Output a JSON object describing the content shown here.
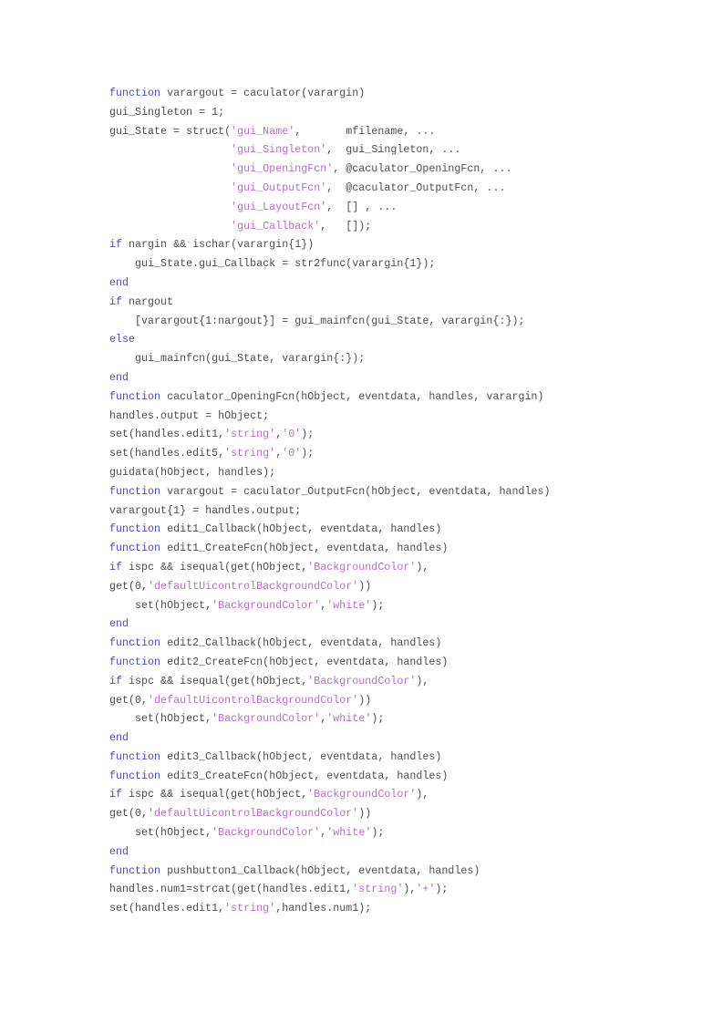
{
  "document": {
    "kind": "source-code-listing",
    "language": "MATLAB",
    "colors": {
      "page_background": "#ffffff",
      "plain_text": "#4d4d4d",
      "keyword": "#4b4bc8",
      "string": "#b96dc8"
    },
    "code_lines": [
      [
        {
          "t": "kw",
          "s": "function"
        },
        {
          "t": "txt",
          "s": " varargout = caculator(varargin)"
        }
      ],
      [
        {
          "t": "txt",
          "s": "gui_Singleton = 1;"
        }
      ],
      [
        {
          "t": "txt",
          "s": "gui_State = struct("
        },
        {
          "t": "str",
          "s": "'gui_Name'"
        },
        {
          "t": "txt",
          "s": ",       mfilename, ..."
        }
      ],
      [
        {
          "t": "txt",
          "s": "                   "
        },
        {
          "t": "str",
          "s": "'gui_Singleton'"
        },
        {
          "t": "txt",
          "s": ",  gui_Singleton, ..."
        }
      ],
      [
        {
          "t": "txt",
          "s": "                   "
        },
        {
          "t": "str",
          "s": "'gui_OpeningFcn'"
        },
        {
          "t": "txt",
          "s": ", @caculator_OpeningFcn, ..."
        }
      ],
      [
        {
          "t": "txt",
          "s": "                   "
        },
        {
          "t": "str",
          "s": "'gui_OutputFcn'"
        },
        {
          "t": "txt",
          "s": ",  @caculator_OutputFcn, ..."
        }
      ],
      [
        {
          "t": "txt",
          "s": "                   "
        },
        {
          "t": "str",
          "s": "'gui_LayoutFcn'"
        },
        {
          "t": "txt",
          "s": ",  [] , ..."
        }
      ],
      [
        {
          "t": "txt",
          "s": "                   "
        },
        {
          "t": "str",
          "s": "'gui_Callback'"
        },
        {
          "t": "txt",
          "s": ",   []);"
        }
      ],
      [
        {
          "t": "kw",
          "s": "if"
        },
        {
          "t": "txt",
          "s": " nargin && ischar(varargin{1})"
        }
      ],
      [
        {
          "t": "txt",
          "s": "    gui_State.gui_Callback = str2func(varargin{1});"
        }
      ],
      [
        {
          "t": "kw",
          "s": "end"
        }
      ],
      [
        {
          "t": "kw",
          "s": "if"
        },
        {
          "t": "txt",
          "s": " nargout"
        }
      ],
      [
        {
          "t": "txt",
          "s": "    [varargout{1:nargout}] = gui_mainfcn(gui_State, varargin{:});"
        }
      ],
      [
        {
          "t": "kw",
          "s": "else"
        }
      ],
      [
        {
          "t": "txt",
          "s": "    gui_mainfcn(gui_State, varargin{:});"
        }
      ],
      [
        {
          "t": "kw",
          "s": "end"
        }
      ],
      [
        {
          "t": "kw",
          "s": "function"
        },
        {
          "t": "txt",
          "s": " caculator_OpeningFcn(hObject, eventdata, handles, varargin)"
        }
      ],
      [
        {
          "t": "txt",
          "s": "handles.output = hObject;"
        }
      ],
      [
        {
          "t": "txt",
          "s": "set(handles.edit1,"
        },
        {
          "t": "str",
          "s": "'string'"
        },
        {
          "t": "txt",
          "s": ","
        },
        {
          "t": "str",
          "s": "'0'"
        },
        {
          "t": "txt",
          "s": ");"
        }
      ],
      [
        {
          "t": "txt",
          "s": "set(handles.edit5,"
        },
        {
          "t": "str",
          "s": "'string'"
        },
        {
          "t": "txt",
          "s": ","
        },
        {
          "t": "str",
          "s": "'0'"
        },
        {
          "t": "txt",
          "s": ");"
        }
      ],
      [
        {
          "t": "txt",
          "s": "guidata(hObject, handles);"
        }
      ],
      [
        {
          "t": "kw",
          "s": "function"
        },
        {
          "t": "txt",
          "s": " varargout = caculator_OutputFcn(hObject, eventdata, handles)"
        }
      ],
      [
        {
          "t": "txt",
          "s": "varargout{1} = handles.output;"
        }
      ],
      [
        {
          "t": "kw",
          "s": "function"
        },
        {
          "t": "txt",
          "s": " edit1_Callback(hObject, eventdata, handles)"
        }
      ],
      [
        {
          "t": "kw",
          "s": "function"
        },
        {
          "t": "txt",
          "s": " edit1_CreateFcn(hObject, eventdata, handles)"
        }
      ],
      [
        {
          "t": "kw",
          "s": "if"
        },
        {
          "t": "txt",
          "s": " ispc && isequal(get(hObject,"
        },
        {
          "t": "str",
          "s": "'BackgroundColor'"
        },
        {
          "t": "txt",
          "s": "),"
        }
      ],
      [
        {
          "t": "txt",
          "s": "get(0,"
        },
        {
          "t": "str",
          "s": "'defaultUicontrolBackgroundColor'"
        },
        {
          "t": "txt",
          "s": "))"
        }
      ],
      [
        {
          "t": "txt",
          "s": "    set(hObject,"
        },
        {
          "t": "str",
          "s": "'BackgroundColor'"
        },
        {
          "t": "txt",
          "s": ","
        },
        {
          "t": "str",
          "s": "'white'"
        },
        {
          "t": "txt",
          "s": ");"
        }
      ],
      [
        {
          "t": "kw",
          "s": "end"
        }
      ],
      [
        {
          "t": "kw",
          "s": "function"
        },
        {
          "t": "txt",
          "s": " edit2_Callback(hObject, eventdata, handles)"
        }
      ],
      [
        {
          "t": "kw",
          "s": "function"
        },
        {
          "t": "txt",
          "s": " edit2_CreateFcn(hObject, eventdata, handles)"
        }
      ],
      [
        {
          "t": "kw",
          "s": "if"
        },
        {
          "t": "txt",
          "s": " ispc && isequal(get(hObject,"
        },
        {
          "t": "str",
          "s": "'BackgroundColor'"
        },
        {
          "t": "txt",
          "s": "),"
        }
      ],
      [
        {
          "t": "txt",
          "s": "get(0,"
        },
        {
          "t": "str",
          "s": "'defaultUicontrolBackgroundColor'"
        },
        {
          "t": "txt",
          "s": "))"
        }
      ],
      [
        {
          "t": "txt",
          "s": "    set(hObject,"
        },
        {
          "t": "str",
          "s": "'BackgroundColor'"
        },
        {
          "t": "txt",
          "s": ","
        },
        {
          "t": "str",
          "s": "'white'"
        },
        {
          "t": "txt",
          "s": ");"
        }
      ],
      [
        {
          "t": "kw",
          "s": "end"
        }
      ],
      [
        {
          "t": "kw",
          "s": "function"
        },
        {
          "t": "txt",
          "s": " edit3_Callback(hObject, eventdata, handles)"
        }
      ],
      [
        {
          "t": "kw",
          "s": "function"
        },
        {
          "t": "txt",
          "s": " edit3_CreateFcn(hObject, eventdata, handles)"
        }
      ],
      [
        {
          "t": "kw",
          "s": "if"
        },
        {
          "t": "txt",
          "s": " ispc && isequal(get(hObject,"
        },
        {
          "t": "str",
          "s": "'BackgroundColor'"
        },
        {
          "t": "txt",
          "s": "),"
        }
      ],
      [
        {
          "t": "txt",
          "s": "get(0,"
        },
        {
          "t": "str",
          "s": "'defaultUicontrolBackgroundColor'"
        },
        {
          "t": "txt",
          "s": "))"
        }
      ],
      [
        {
          "t": "txt",
          "s": "    set(hObject,"
        },
        {
          "t": "str",
          "s": "'BackgroundColor'"
        },
        {
          "t": "txt",
          "s": ","
        },
        {
          "t": "str",
          "s": "'white'"
        },
        {
          "t": "txt",
          "s": ");"
        }
      ],
      [
        {
          "t": "kw",
          "s": "end"
        }
      ],
      [
        {
          "t": "kw",
          "s": "function"
        },
        {
          "t": "txt",
          "s": " pushbutton1_Callback(hObject, eventdata, handles)"
        }
      ],
      [
        {
          "t": "txt",
          "s": "handles.num1=strcat(get(handles.edit1,"
        },
        {
          "t": "str",
          "s": "'string'"
        },
        {
          "t": "txt",
          "s": "),"
        },
        {
          "t": "str",
          "s": "'+'"
        },
        {
          "t": "txt",
          "s": ");"
        }
      ],
      [
        {
          "t": "txt",
          "s": "set(handles.edit1,"
        },
        {
          "t": "str",
          "s": "'string'"
        },
        {
          "t": "txt",
          "s": ",handles.num1);"
        }
      ]
    ]
  }
}
